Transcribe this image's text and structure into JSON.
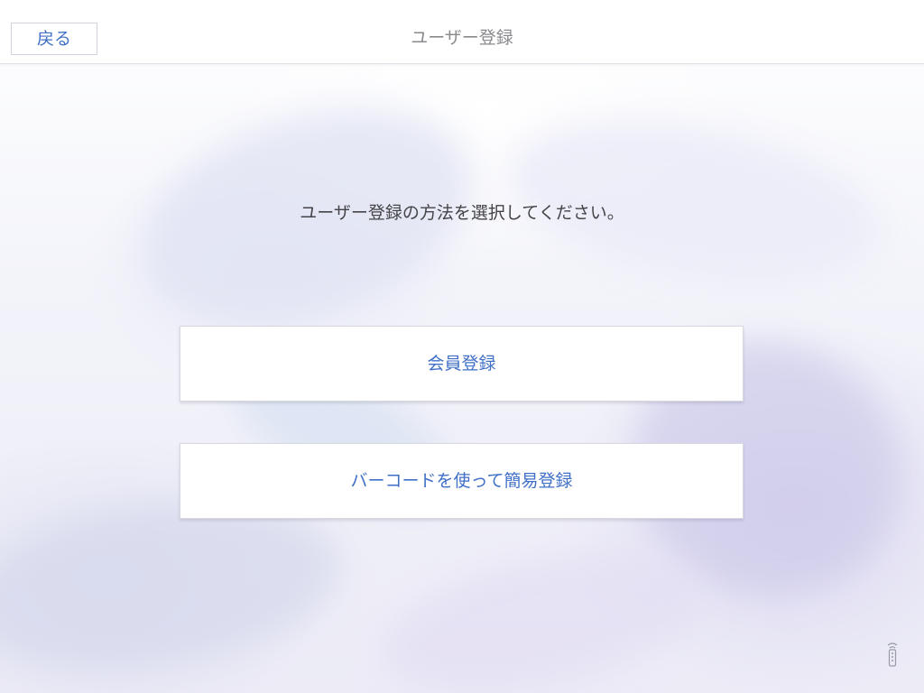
{
  "header": {
    "back_label": "戻る",
    "title": "ユーザー登録"
  },
  "main": {
    "prompt": "ユーザー登録の方法を選択してください。",
    "options": [
      {
        "label": "会員登録"
      },
      {
        "label": "バーコードを使って簡易登録"
      }
    ]
  },
  "icons": {
    "corner_icon": "remote-signal-icon"
  },
  "colors": {
    "accent": "#3f6fc6",
    "title_text": "#8a8a8e",
    "body_text": "#444448"
  }
}
